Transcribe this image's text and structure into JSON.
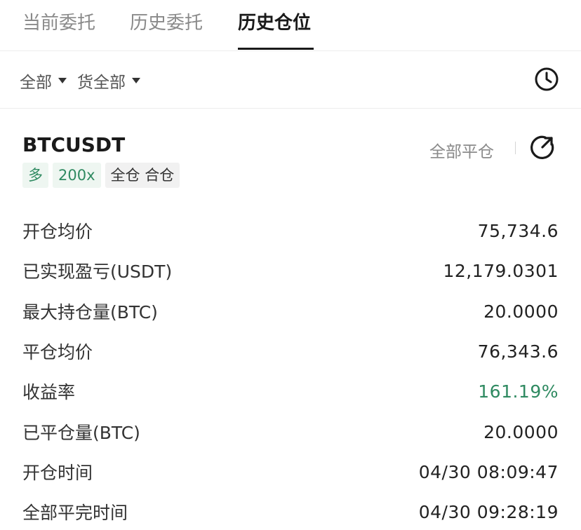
{
  "tabs": [
    {
      "label": "当前委托",
      "active": false
    },
    {
      "label": "历史委托",
      "active": false
    },
    {
      "label": "历史仓位",
      "active": true
    }
  ],
  "filters": {
    "filter1_label": "全部",
    "filter2_label": "货全部",
    "history_icon": "clock-icon"
  },
  "position": {
    "symbol": "BTCUSDT",
    "close_all_label": "全部平仓",
    "share_icon": "share-arrow-icon",
    "badges": {
      "direction": "多",
      "leverage": "200x",
      "margin_mode": "全仓 合仓"
    },
    "rows": [
      {
        "label": "开仓均价",
        "value": "75,734.6"
      },
      {
        "label": "已实现盈亏(USDT)",
        "value": "12,179.0301"
      },
      {
        "label": "最大持仓量(BTC)",
        "value": "20.0000"
      },
      {
        "label": "平仓均价",
        "value": "76,343.6"
      },
      {
        "label": "收益率",
        "value": "161.19%"
      },
      {
        "label": "已平仓量(BTC)",
        "value": "20.0000"
      },
      {
        "label": "开仓时间",
        "value": "04/30 08:09:47"
      },
      {
        "label": "全部平完时间",
        "value": "04/30 09:28:19"
      }
    ]
  },
  "colors": {
    "positive": "#2f8a61",
    "badge_green_bg": "#eef6f1"
  }
}
